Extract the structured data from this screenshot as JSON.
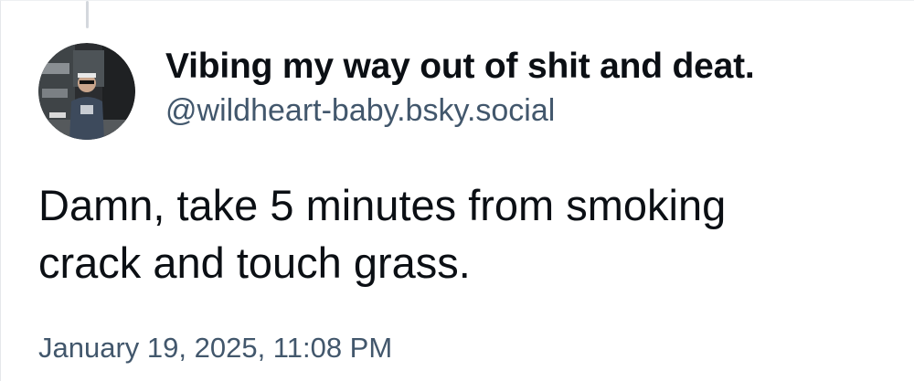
{
  "post": {
    "author": {
      "display_name": "Vibing my way out of shit and deat.",
      "handle": "@wildheart-baby.bsky.social",
      "avatar_icon": "user-avatar-photo"
    },
    "text_lines": [
      "Damn, take 5 minutes from smoking",
      "crack and touch grass."
    ],
    "timestamp": "January 19, 2025, 11:08 PM"
  },
  "colors": {
    "name_text": "#0b0f14",
    "secondary_text": "#42576c",
    "thread_line": "#d4d8dd"
  }
}
